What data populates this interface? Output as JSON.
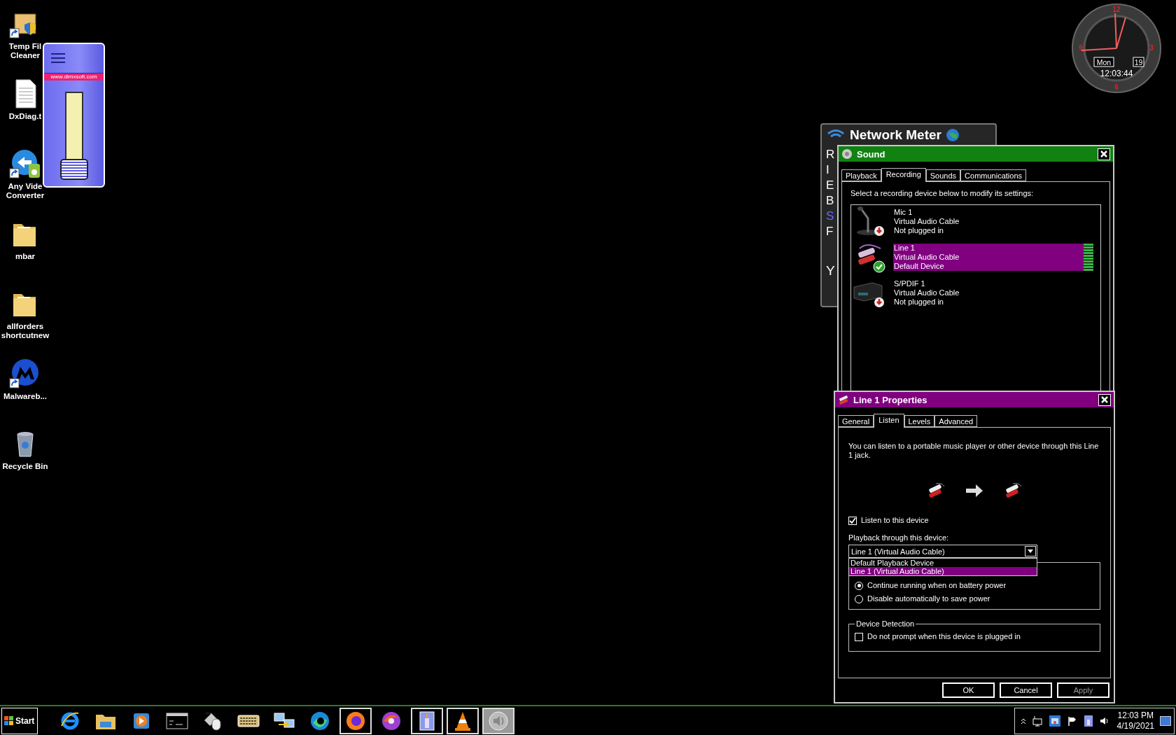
{
  "desktop_icons": [
    {
      "kind": "cleaner",
      "shortcut": true,
      "lines": [
        "Temp Fil",
        "Cleaner"
      ]
    },
    {
      "kind": "text-file",
      "shortcut": false,
      "lines": [
        "DxDiag.t"
      ]
    },
    {
      "kind": "converter",
      "shortcut": true,
      "lines": [
        "Any Vide",
        "Converter"
      ]
    },
    {
      "kind": "folder",
      "shortcut": false,
      "lines": [
        "mbar"
      ]
    },
    {
      "kind": "folder",
      "shortcut": false,
      "lines": [
        "allforders",
        "shortcutnew"
      ]
    },
    {
      "kind": "malware",
      "shortcut": true,
      "lines": [
        "Malwareb..."
      ]
    },
    {
      "kind": "bin",
      "shortcut": false,
      "lines": [
        "Recycle Bin"
      ]
    }
  ],
  "volume_widget": {
    "url": "www.dimxsoft.com",
    "level": 0.0
  },
  "clock": {
    "numerals": [
      "12",
      "3",
      "6",
      "9"
    ],
    "day": "Mon",
    "date": "19",
    "time": "12:03:44"
  },
  "network_meter": {
    "title": "Network Meter",
    "rows": [
      {
        "text": "R",
        "link": false
      },
      {
        "text": "I",
        "link": false
      },
      {
        "text": "E",
        "link": false
      },
      {
        "text": "B",
        "link": false
      },
      {
        "text": "S",
        "link": true
      },
      {
        "text": "F",
        "link": false
      }
    ],
    "footer": "Y"
  },
  "sound_dialog": {
    "title": "Sound",
    "tabs": [
      {
        "label": "Playback",
        "selected": false
      },
      {
        "label": "Recording",
        "selected": true
      },
      {
        "label": "Sounds",
        "selected": false
      },
      {
        "label": "Communications",
        "selected": false
      }
    ],
    "instruction": "Select a recording device below to modify its settings:",
    "devices": [
      {
        "kind": "microphone",
        "default": false,
        "name": "Mic 1",
        "driver": "Virtual Audio Cable",
        "status": "Not plugged in",
        "selected": false
      },
      {
        "kind": "line",
        "default": true,
        "name": "Line 1",
        "driver": "Virtual Audio Cable",
        "status": "Default Device",
        "selected": true,
        "level": 1.0
      },
      {
        "kind": "spdif",
        "default": false,
        "name": "S/PDIF 1",
        "driver": "Virtual Audio Cable",
        "status": "Not plugged in",
        "selected": false
      }
    ]
  },
  "properties_dialog": {
    "title": "Line 1 Properties",
    "tabs": [
      {
        "label": "General",
        "selected": false
      },
      {
        "label": "Listen",
        "selected": true
      },
      {
        "label": "Levels",
        "selected": false
      },
      {
        "label": "Advanced",
        "selected": false
      }
    ],
    "description": "You can listen to a portable music player or other device through this Line 1 jack.",
    "listen_checkbox": {
      "label": "Listen to this device",
      "checked": true
    },
    "playback_label": "Playback through this device:",
    "playback_select": {
      "value": "Line 1 (Virtual Audio Cable)",
      "expanded": true,
      "options": [
        {
          "label": "Default Playback Device",
          "selected": false
        },
        {
          "label": "Line 1 (Virtual Audio Cable)",
          "selected": true
        }
      ]
    },
    "power_options": [
      {
        "label": "Continue running when on battery power",
        "selected": true
      },
      {
        "label": "Disable automatically to save power",
        "selected": false
      }
    ],
    "device_detection": {
      "title": "Device Detection",
      "checkbox": {
        "label": "Do not prompt when this device is plugged in",
        "checked": false
      }
    },
    "buttons": [
      {
        "label": "OK",
        "disabled": false
      },
      {
        "label": "Cancel",
        "disabled": false
      },
      {
        "label": "Apply",
        "disabled": true
      }
    ]
  },
  "taskbar": {
    "start_label": "Start",
    "apps": [
      {
        "kind": "browser-e",
        "running": false,
        "selected": false
      },
      {
        "kind": "file-explorer",
        "running": false,
        "selected": false
      },
      {
        "kind": "media-player",
        "running": false,
        "selected": false
      },
      {
        "kind": "console",
        "running": false,
        "selected": false
      },
      {
        "kind": "mouse-keyboard",
        "running": false,
        "selected": false
      },
      {
        "kind": "keyboard",
        "running": false,
        "selected": false
      },
      {
        "kind": "network",
        "running": false,
        "selected": false
      },
      {
        "kind": "browser-wave",
        "running": false,
        "selected": false
      },
      {
        "kind": "fox-browser",
        "running": true,
        "selected": false
      },
      {
        "kind": "swirl",
        "running": false,
        "selected": false
      },
      {
        "kind": "candle",
        "running": true,
        "selected": false
      },
      {
        "kind": "cone",
        "running": true,
        "selected": false
      },
      {
        "kind": "speaker",
        "running": true,
        "selected": true
      }
    ],
    "tray": [
      {
        "kind": "chevron"
      },
      {
        "kind": "network"
      },
      {
        "kind": "app"
      },
      {
        "kind": "flag"
      },
      {
        "kind": "candle"
      },
      {
        "kind": "volume"
      }
    ],
    "time": "12:03 PM",
    "date": "4/19/2021"
  }
}
